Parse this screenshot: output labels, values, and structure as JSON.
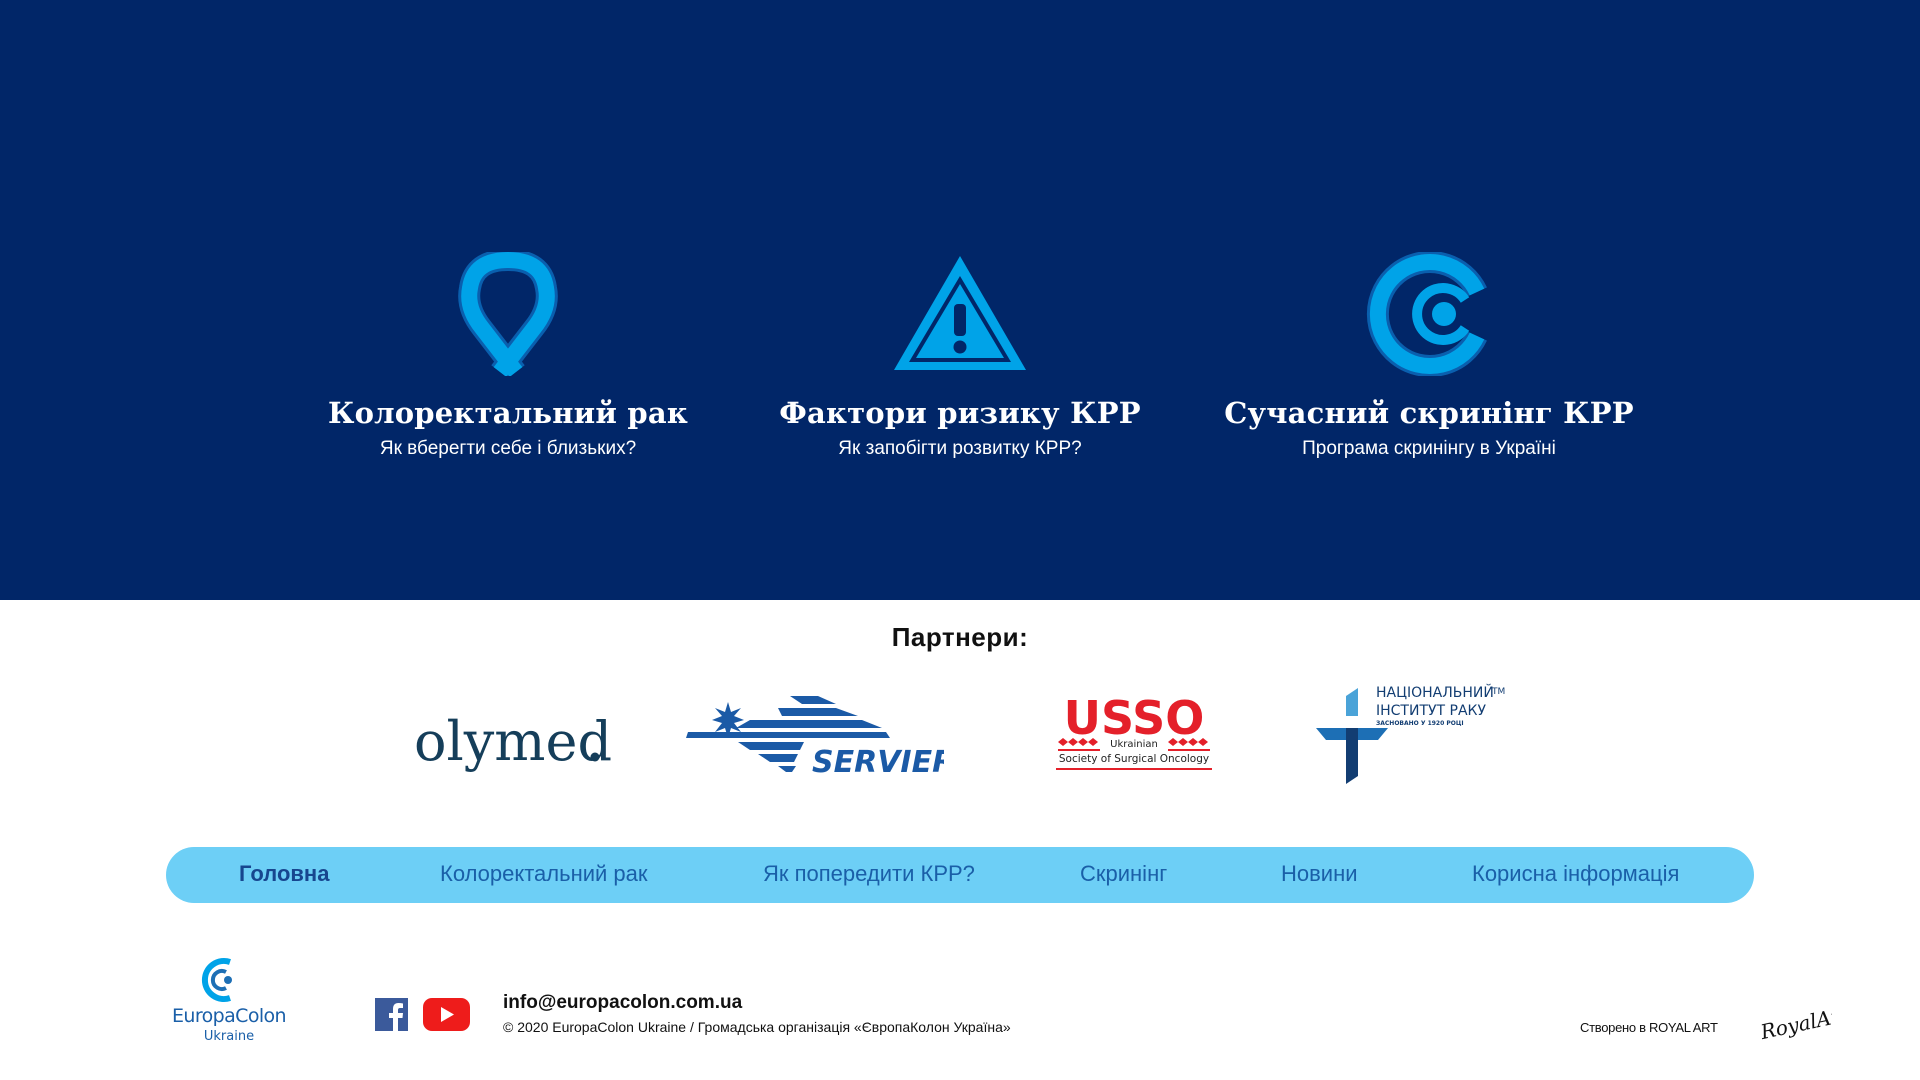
{
  "features": [
    {
      "icon": "ribbon-icon",
      "title": "Колоректальний рак",
      "subtitle": "Як вберегти себе і близьких?"
    },
    {
      "icon": "warning-triangle-icon",
      "title": "Фактори ризику КРР",
      "subtitle": "Як запобігти розвитку КРР?"
    },
    {
      "icon": "screening-c-icon",
      "title": "Сучасний скринінг КРР",
      "subtitle": "Програма скринінгу в Україні"
    }
  ],
  "partners": {
    "title": "Партнери:",
    "olymed": "olymed",
    "servier": "SERVIER",
    "usso": {
      "name": "USSO",
      "line1": "Ukrainian",
      "line2": "Society of Surgical Oncology"
    },
    "nci": {
      "line1": "НАЦІОНАЛЬНИЙ",
      "line2": "ІНСТИТУТ РАКУ",
      "tm": "TM",
      "line3": "ЗАСНОВАНО У 1920 РОЦІ"
    }
  },
  "nav": {
    "items": [
      "Головна",
      "Колоректальний рак",
      "Як попередити КРР?",
      "Скринінг",
      "Новини",
      "Корисна інформація"
    ],
    "active": "Головна"
  },
  "footer": {
    "logo_name": "EuropaColon",
    "logo_sub": "Ukraine",
    "email": "info@europacolon.com.ua",
    "copyright": "© 2020 EuropaColon Ukraine / Громадська організація «ЄвропаКолон Україна»",
    "created": "Створено в ROYAL ART",
    "royal_logo": "RoyalArt.",
    "social": [
      "facebook-icon",
      "youtube-icon"
    ]
  },
  "colors": {
    "hero_bg": "#012668",
    "accent": "#00a3e8",
    "nav_bg": "#6dcff6",
    "nav_text": "#1a5fa8"
  }
}
